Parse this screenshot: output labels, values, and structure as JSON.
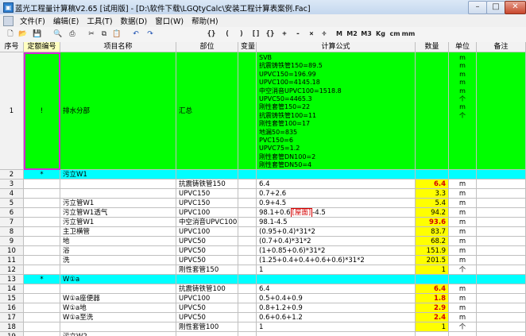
{
  "title_bar": {
    "app_icon": "app-icon",
    "title": "蓝光工程量计算稿V2.65 [试用版] - [D:\\软件下载\\LGQtyCalc\\安装工程计算表案例.Fac]",
    "minimize": "–",
    "maximize": "□",
    "close": "✕"
  },
  "menu": [
    "文件(F)",
    "编辑(E)",
    "工具(T)",
    "数据(D)",
    "窗口(W)",
    "帮助(H)"
  ],
  "toolbar": {
    "icons": [
      "new-file-icon",
      "open-folder-icon",
      "save-icon",
      "print-preview-icon",
      "print-icon",
      "cut-icon",
      "copy-icon",
      "paste-icon",
      "undo-icon",
      "redo-icon"
    ],
    "symbols": [
      "{}",
      "(",
      ")",
      "[]",
      "{}",
      "+",
      "-",
      "×",
      "÷"
    ],
    "units": [
      "M",
      "M2",
      "M3",
      "Kg",
      "cm",
      "mm"
    ]
  },
  "columns": [
    "序号",
    "定额编号",
    "项目名称",
    "部位",
    "变量",
    "计算公式",
    "数量",
    "单位",
    "备注"
  ],
  "rows": [
    {
      "no": "1",
      "code": "!",
      "name": "排水分部",
      "part": "汇总",
      "var": "",
      "formula": "SVB\n抗震铸铁管150=89.5\nUPVC150=196.99\nUPVC100=4145.18\n中空消音UPVC100=1518.8\nUPVC50=4465.3\n刚性套管150=22\n抗震铸铁管100=11\n刚性套管100=17\n地漏50=835\nPVC150=6\nUPVC75=1.2\n刚性套管DN100=2\n刚性套管DN50=4",
      "qty": "",
      "unit": "m\nm\nm\nm\nm\n个\nm\n个",
      "note": "",
      "style": "green"
    },
    {
      "no": "2",
      "code": "*",
      "name": "污立W1",
      "part": "",
      "var": "",
      "formula": "",
      "qty": "",
      "unit": "",
      "note": "",
      "style": "cyan"
    },
    {
      "no": "3",
      "code": "",
      "name": "",
      "part": "抗震铸铁管150",
      "var": "",
      "formula": "6.4",
      "qty": "6.4",
      "unit": "m",
      "note": "",
      "style": "normal",
      "qty_red": true
    },
    {
      "no": "4",
      "code": "",
      "name": "",
      "part": "UPVC150",
      "var": "",
      "formula": "0.7+2.6",
      "qty": "3.3",
      "unit": "m",
      "note": "",
      "style": "normal"
    },
    {
      "no": "5",
      "code": "",
      "name": "污立管W1",
      "part": "UPVC150",
      "var": "",
      "formula": "0.9+4.5",
      "qty": "5.4",
      "unit": "m",
      "note": "",
      "style": "normal"
    },
    {
      "no": "6",
      "code": "",
      "name": "污立管W1透气",
      "part": "UPVC100",
      "var": "",
      "formula": "98.1+0.6",
      "tag": "[屋面]",
      "formula_tail": "-4.5",
      "qty": "94.2",
      "unit": "m",
      "note": "",
      "style": "normal"
    },
    {
      "no": "7",
      "code": "",
      "name": "污立管W1",
      "part": "中空消音UPVC100",
      "var": "",
      "formula": "98.1-4.5",
      "qty": "93.6",
      "unit": "m",
      "note": "",
      "style": "normal",
      "qty_red": true
    },
    {
      "no": "8",
      "code": "",
      "name": "主卫横管",
      "part": "UPVC100",
      "var": "",
      "formula": "(0.95+0.4)*31*2",
      "qty": "83.7",
      "unit": "m",
      "note": "",
      "style": "normal"
    },
    {
      "no": "9",
      "code": "",
      "name": "地",
      "part": "UPVC50",
      "var": "",
      "formula": "(0.7+0.4)*31*2",
      "qty": "68.2",
      "unit": "m",
      "note": "",
      "style": "normal"
    },
    {
      "no": "10",
      "code": "",
      "name": "浴",
      "part": "UPVC50",
      "var": "",
      "formula": "(1+0.85+0.6)*31*2",
      "qty": "151.9",
      "unit": "m",
      "note": "",
      "style": "normal"
    },
    {
      "no": "11",
      "code": "",
      "name": "洗",
      "part": "UPVC50",
      "var": "",
      "formula": "(1.25+0.4+0.4+0.6+0.6)*31*2",
      "qty": "201.5",
      "unit": "m",
      "note": "",
      "style": "normal"
    },
    {
      "no": "12",
      "code": "",
      "name": "",
      "part": "刚性套管150",
      "var": "",
      "formula": "1",
      "qty": "1",
      "unit": "个",
      "note": "",
      "style": "normal"
    },
    {
      "no": "13",
      "code": "*",
      "name": "W①a",
      "part": "",
      "var": "",
      "formula": "",
      "qty": "",
      "unit": "",
      "note": "",
      "style": "cyan"
    },
    {
      "no": "14",
      "code": "",
      "name": "",
      "part": "抗震铸铁管100",
      "var": "",
      "formula": "6.4",
      "qty": "6.4",
      "unit": "m",
      "note": "",
      "style": "normal",
      "qty_red": true
    },
    {
      "no": "15",
      "code": "",
      "name": "W①a座便器",
      "part": "UPVC100",
      "var": "",
      "formula": "0.5+0.4+0.9",
      "qty": "1.8",
      "unit": "m",
      "note": "",
      "style": "normal",
      "qty_red": true
    },
    {
      "no": "16",
      "code": "",
      "name": "W①a地",
      "part": "UPVC50",
      "var": "",
      "formula": "0.8+1.2+0.9",
      "qty": "2.9",
      "unit": "m",
      "note": "",
      "style": "normal",
      "qty_red": true
    },
    {
      "no": "17",
      "code": "",
      "name": "W①a至洗",
      "part": "UPVC50",
      "var": "",
      "formula": "0.6+0.6+1.2",
      "qty": "2.4",
      "unit": "m",
      "note": "",
      "style": "normal",
      "qty_red": true
    },
    {
      "no": "18",
      "code": "",
      "name": "",
      "part": "刚性套管100",
      "var": "",
      "formula": "1",
      "qty": "1",
      "unit": "个",
      "note": "",
      "style": "normal"
    },
    {
      "no": "19",
      "code": "",
      "name": "污立W2",
      "part": "",
      "var": "",
      "formula": "",
      "qty": "",
      "unit": "",
      "note": "",
      "style": "normal"
    }
  ],
  "colors": {
    "green": "#00ff00",
    "cyan": "#00ffff",
    "yellow": "#ffff00",
    "red": "#d40000",
    "selection": "#d32bd3"
  }
}
